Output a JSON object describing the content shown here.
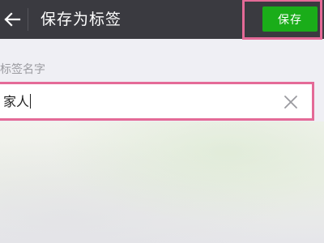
{
  "header": {
    "title": "保存为标签",
    "back_icon": "back-arrow-icon",
    "save_label": "保存",
    "save_color": "#1aad19"
  },
  "form": {
    "field_label": "标签名字",
    "field_value": "家人",
    "clear_icon": "close-icon"
  },
  "colors": {
    "top_bar": "#3a3a40",
    "background": "#efeff4",
    "highlight_annotation": "#e46a97"
  }
}
